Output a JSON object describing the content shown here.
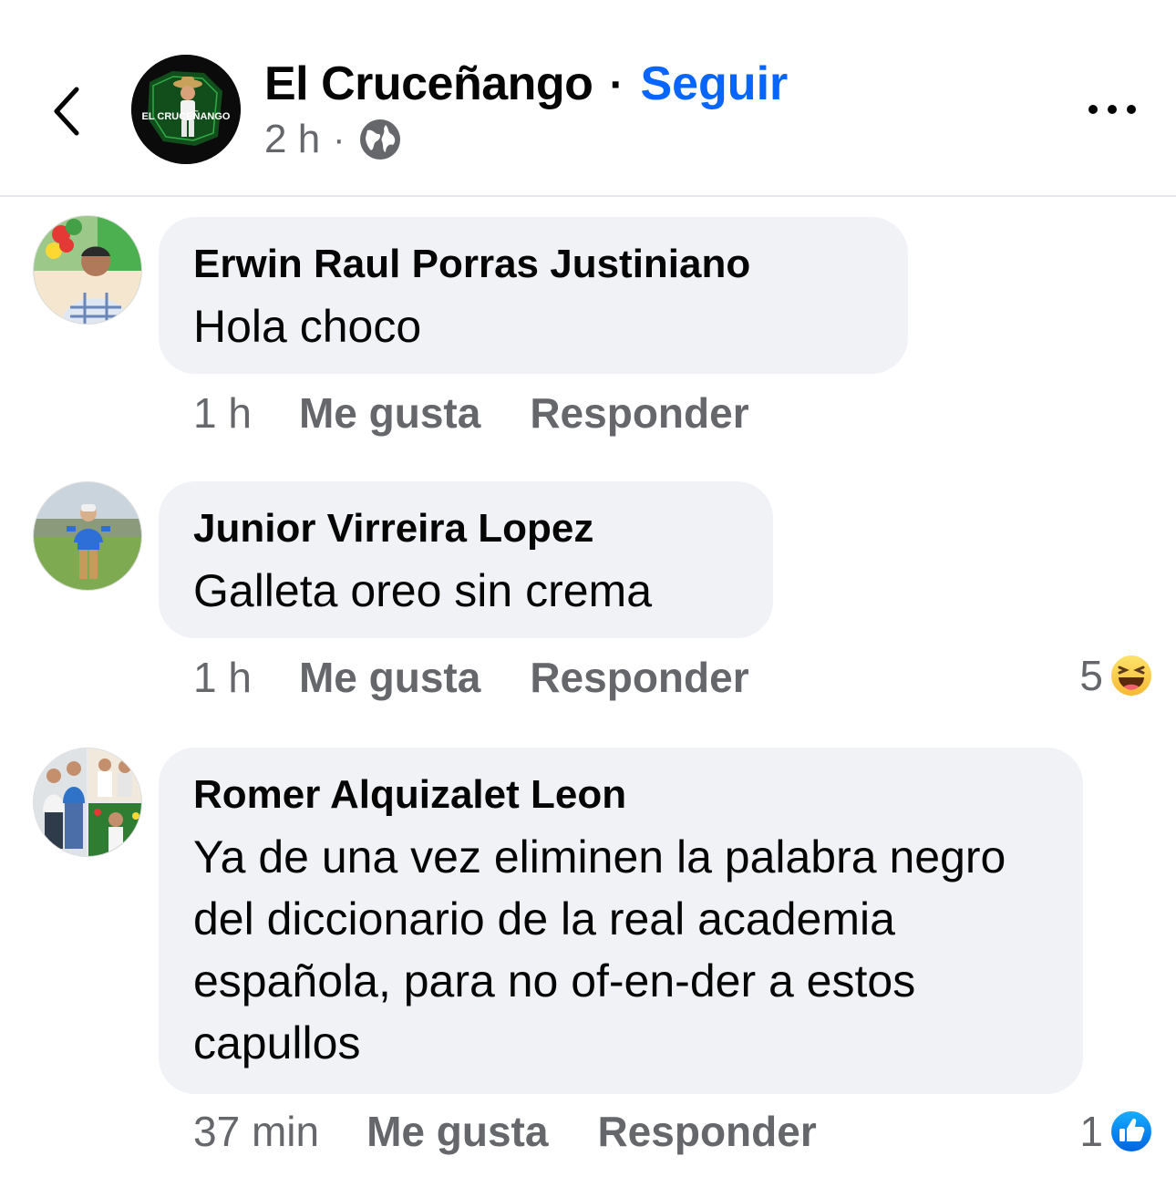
{
  "header": {
    "page_name": "El Cruceñango",
    "separator": "·",
    "follow_label": "Seguir",
    "post_time": "2 h",
    "meta_separator": "·",
    "avatar_text": "EL CRUCEÑANGO",
    "icons": {
      "back": "chevron-left-icon",
      "audience": "globe-icon",
      "more": "more-options-icon"
    }
  },
  "comments": [
    {
      "author": "Erwin Raul Porras Justiniano",
      "text": "Hola choco",
      "time": "1 h",
      "like_label": "Me gusta",
      "reply_label": "Responder",
      "reaction_count": "",
      "reaction_icon": ""
    },
    {
      "author": "Junior Virreira Lopez",
      "text": "Galleta oreo sin crema",
      "time": "1 h",
      "like_label": "Me gusta",
      "reply_label": "Responder",
      "reaction_count": "5",
      "reaction_icon": "haha-emoji-icon"
    },
    {
      "author": "Romer Alquizalet Leon",
      "text": "Ya de una vez eliminen la palabra negro del diccionario de la real academia española, para no of-en-der a estos capullos",
      "time": "37 min",
      "like_label": "Me gusta",
      "reply_label": "Responder",
      "reaction_count": "1",
      "reaction_icon": "like-thumb-icon"
    }
  ],
  "colors": {
    "accent_blue": "#0866ff",
    "bubble_bg": "#f0f2f5",
    "secondary_text": "#65676b",
    "primary_text": "#050505"
  }
}
